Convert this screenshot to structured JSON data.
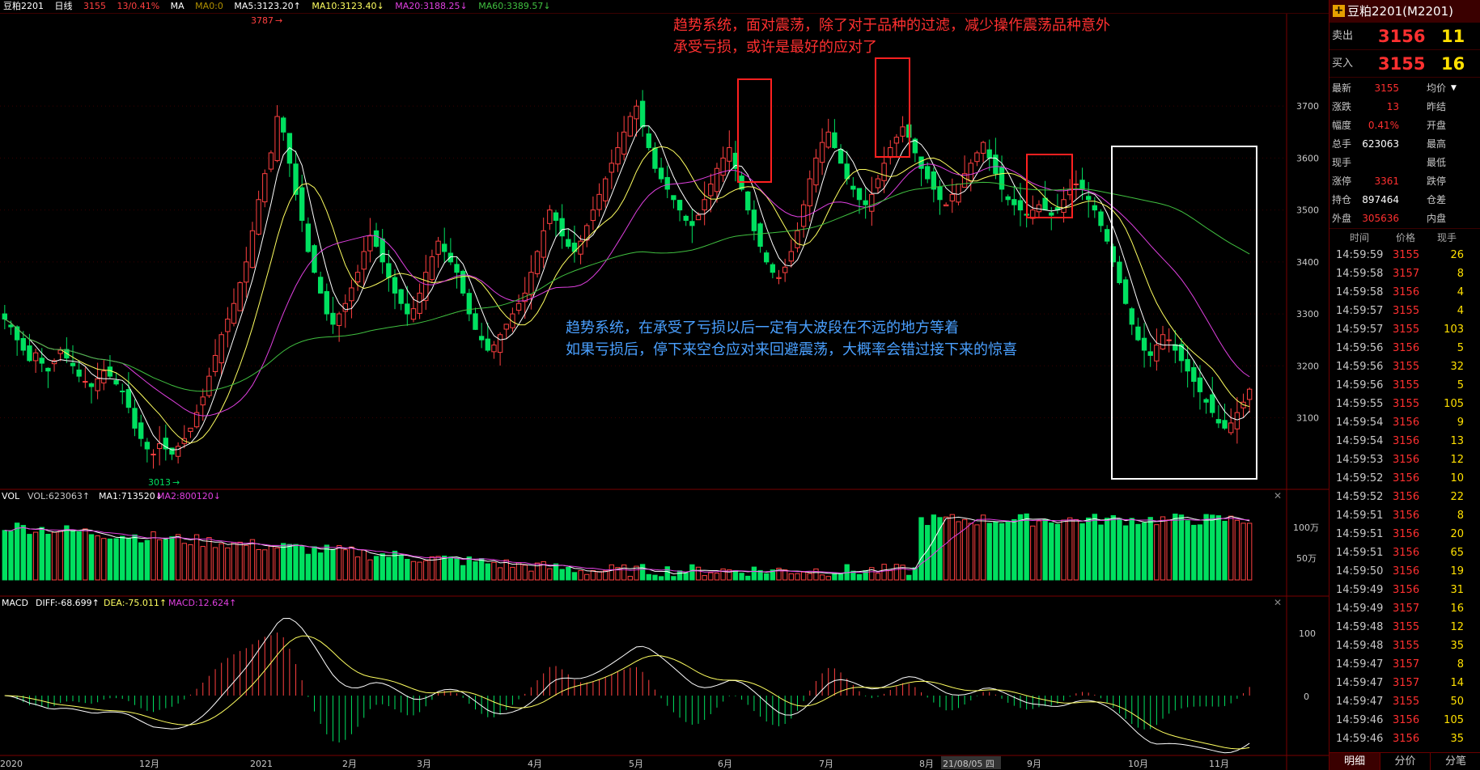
{
  "topbar": {
    "symbol": "豆粕2201",
    "period": "日线",
    "last": "3155",
    "change": "13/0.41%",
    "ma_label": "MA",
    "ma0": "MA0:0",
    "ma5": "MA5:3123.20↑",
    "ma10": "MA10:3123.40↓",
    "ma20": "MA20:3188.25↓",
    "ma60": "MA60:3389.57↓"
  },
  "colors": {
    "up": "#ff4040",
    "down": "#00e060",
    "ma5": "#ffffff",
    "ma10": "#ffff60",
    "ma20": "#e040e0",
    "ma60": "#40c040",
    "annotation_red": "#ff3030",
    "annotation_blue": "#4aa0ff"
  },
  "annotations": {
    "top_line1": "趋势系统，面对震荡，除了对于品种的过滤，减少操作震荡品种意外",
    "top_line2": "承受亏损，或许是最好的应对了",
    "mid_line1": "趋势系统，在承受了亏损以后一定有大波段在不远的地方等着",
    "mid_line2": "如果亏损后，停下来空仓应对来回避震荡，大概率会错过接下来的惊喜",
    "high_label": "3787",
    "low_label": "3013"
  },
  "vol_header": {
    "label": "VOL",
    "vol": "VOL:623063↑",
    "ma1": "MA1:713520↓",
    "ma2": "MA2:800120↓"
  },
  "macd_header": {
    "label": "MACD",
    "diff": "DIFF:-68.699↑",
    "dea": "DEA:-75.011↑",
    "macd": "MACD:12.624↑"
  },
  "x_labels": [
    "2020",
    "12月",
    "2021",
    "2月",
    "3月",
    "4月",
    "5月",
    "6月",
    "7月",
    "8月",
    "21/08/05 四",
    "9月",
    "10月",
    "11月"
  ],
  "chart_data": [
    {
      "type": "candlestick",
      "title": "豆粕2201 日线",
      "y_ticks": [
        3100,
        3200,
        3300,
        3400,
        3500,
        3600,
        3700
      ],
      "ylim": [
        2970,
        3870
      ],
      "x_months": [
        "12月",
        "2021",
        "2月",
        "3月",
        "4月",
        "5月",
        "6月",
        "7月",
        "8月",
        "9月",
        "10月",
        "11月"
      ],
      "close": [
        3290,
        3275,
        3250,
        3230,
        3210,
        3225,
        3205,
        3190,
        3210,
        3230,
        3215,
        3200,
        3180,
        3170,
        3160,
        3175,
        3190,
        3180,
        3165,
        3150,
        3120,
        3080,
        3060,
        3040,
        3030,
        3050,
        3040,
        3030,
        3045,
        3060,
        3080,
        3110,
        3140,
        3180,
        3220,
        3260,
        3290,
        3320,
        3360,
        3400,
        3460,
        3520,
        3570,
        3610,
        3680,
        3650,
        3590,
        3530,
        3480,
        3420,
        3380,
        3340,
        3300,
        3280,
        3300,
        3320,
        3350,
        3380,
        3420,
        3450,
        3430,
        3400,
        3370,
        3340,
        3320,
        3300,
        3310,
        3340,
        3380,
        3410,
        3440,
        3420,
        3400,
        3380,
        3340,
        3300,
        3270,
        3250,
        3230,
        3240,
        3260,
        3280,
        3300,
        3320,
        3340,
        3380,
        3420,
        3460,
        3500,
        3480,
        3450,
        3430,
        3420,
        3440,
        3470,
        3500,
        3530,
        3560,
        3590,
        3620,
        3650,
        3680,
        3700,
        3660,
        3620,
        3580,
        3560,
        3540,
        3520,
        3500,
        3480,
        3470,
        3490,
        3520,
        3550,
        3580,
        3600,
        3620,
        3580,
        3540,
        3500,
        3460,
        3430,
        3400,
        3380,
        3370,
        3390,
        3420,
        3460,
        3510,
        3560,
        3600,
        3630,
        3650,
        3620,
        3590,
        3560,
        3540,
        3520,
        3510,
        3530,
        3560,
        3590,
        3620,
        3640,
        3660,
        3640,
        3610,
        3580,
        3560,
        3540,
        3520,
        3510,
        3530,
        3550,
        3570,
        3590,
        3610,
        3630,
        3600,
        3570,
        3540,
        3520,
        3510,
        3500,
        3490,
        3500,
        3510,
        3500,
        3490,
        3500,
        3520,
        3540,
        3550,
        3540,
        3520,
        3500,
        3470,
        3440,
        3400,
        3360,
        3320,
        3280,
        3250,
        3230,
        3220,
        3240,
        3260,
        3250,
        3230,
        3210,
        3190,
        3170,
        3150,
        3130,
        3110,
        3090,
        3080,
        3090,
        3110,
        3130,
        3155
      ],
      "ma60_end": 3389.57,
      "ma20_end": 3188.25,
      "ma10_end": 3123.4,
      "ma5_end": 3123.2,
      "high_mark": 3787,
      "low_mark": 3013
    },
    {
      "type": "bar",
      "title": "VOL",
      "y_ticks_label": [
        "100万",
        "50万"
      ],
      "y_ticks": [
        1000000,
        500000
      ],
      "last_volume": 623063,
      "ma1": 713520,
      "ma2": 800120
    },
    {
      "type": "line",
      "title": "MACD",
      "y_ticks": [
        100,
        0
      ],
      "diff_end": -68.699,
      "dea_end": -75.011,
      "macd_end": 12.624
    }
  ],
  "panel": {
    "title": "豆粕2201(M2201)",
    "sell_label": "卖出",
    "sell_price": "3156",
    "sell_vol": "11",
    "buy_label": "买入",
    "buy_price": "3155",
    "buy_vol": "16",
    "quote_rows": [
      {
        "k1": "最新",
        "v1": "3155",
        "k2": "均价",
        "v2": ""
      },
      {
        "k1": "涨跌",
        "v1": "13",
        "k2": "昨结",
        "v2": ""
      },
      {
        "k1": "幅度",
        "v1": "0.41%",
        "k2": "开盘",
        "v2": ""
      },
      {
        "k1": "总手",
        "v1": "623063",
        "k2": "最高",
        "v2": ""
      },
      {
        "k1": "现手",
        "v1": "",
        "k2": "最低",
        "v2": ""
      },
      {
        "k1": "涨停",
        "v1": "3361",
        "k2": "跌停",
        "v2": ""
      },
      {
        "k1": "持仓",
        "v1": "897464",
        "k2": "仓差",
        "v2": ""
      },
      {
        "k1": "外盘",
        "v1": "305636",
        "k2": "内盘",
        "v2": ""
      }
    ],
    "tick_header": {
      "time": "时间",
      "price": "价格",
      "vol": "现手"
    },
    "ticks": [
      {
        "t": "14:59:59",
        "p": "3155",
        "v": "26"
      },
      {
        "t": "14:59:58",
        "p": "3157",
        "v": "8"
      },
      {
        "t": "14:59:58",
        "p": "3156",
        "v": "4"
      },
      {
        "t": "14:59:57",
        "p": "3155",
        "v": "4"
      },
      {
        "t": "14:59:57",
        "p": "3155",
        "v": "103"
      },
      {
        "t": "14:59:56",
        "p": "3156",
        "v": "5"
      },
      {
        "t": "14:59:56",
        "p": "3155",
        "v": "32"
      },
      {
        "t": "14:59:56",
        "p": "3155",
        "v": "5"
      },
      {
        "t": "14:59:55",
        "p": "3155",
        "v": "105"
      },
      {
        "t": "14:59:54",
        "p": "3156",
        "v": "9"
      },
      {
        "t": "14:59:54",
        "p": "3156",
        "v": "13"
      },
      {
        "t": "14:59:53",
        "p": "3156",
        "v": "12"
      },
      {
        "t": "14:59:52",
        "p": "3156",
        "v": "10"
      },
      {
        "t": "14:59:52",
        "p": "3156",
        "v": "22"
      },
      {
        "t": "14:59:51",
        "p": "3156",
        "v": "8"
      },
      {
        "t": "14:59:51",
        "p": "3156",
        "v": "20"
      },
      {
        "t": "14:59:51",
        "p": "3156",
        "v": "65"
      },
      {
        "t": "14:59:50",
        "p": "3156",
        "v": "19"
      },
      {
        "t": "14:59:49",
        "p": "3156",
        "v": "31"
      },
      {
        "t": "14:59:49",
        "p": "3157",
        "v": "16"
      },
      {
        "t": "14:59:48",
        "p": "3155",
        "v": "12"
      },
      {
        "t": "14:59:48",
        "p": "3155",
        "v": "35"
      },
      {
        "t": "14:59:47",
        "p": "3157",
        "v": "8"
      },
      {
        "t": "14:59:47",
        "p": "3157",
        "v": "14"
      },
      {
        "t": "14:59:47",
        "p": "3155",
        "v": "50"
      },
      {
        "t": "14:59:46",
        "p": "3156",
        "v": "105"
      },
      {
        "t": "14:59:46",
        "p": "3156",
        "v": "35"
      }
    ],
    "tabs": [
      "明细",
      "分价",
      "分笔"
    ]
  }
}
